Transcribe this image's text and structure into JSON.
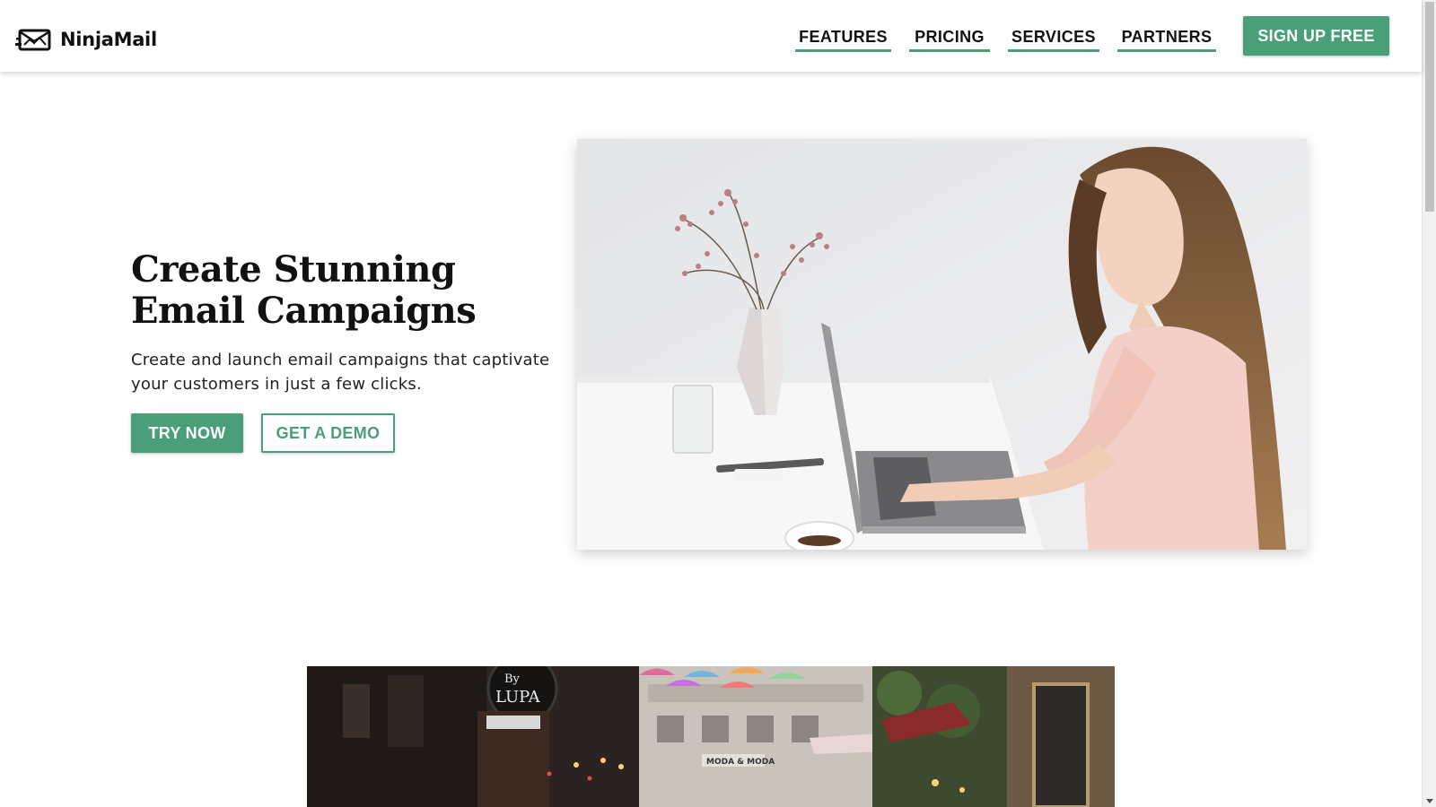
{
  "brand": {
    "name": "NinjaMail",
    "logo_icon": "envelope-icon",
    "accent_color": "#4a9e78"
  },
  "nav": {
    "items": [
      {
        "label": "FEATURES"
      },
      {
        "label": "PRICING"
      },
      {
        "label": "SERVICES"
      },
      {
        "label": "PARTNERS"
      }
    ],
    "signup_label": "SIGN UP FREE"
  },
  "hero": {
    "title": "Create Stunning Email Campaigns",
    "subtitle": "Create and launch email campaigns that captivate your customers in just a few clicks.",
    "try_label": "TRY NOW",
    "demo_label": "GET A DEMO",
    "image_alt": "woman-working-on-laptop-image"
  },
  "street": {
    "sign_text_top": "By",
    "sign_text_bottom": "LUPA",
    "shop_sign": "MODA & MODA"
  }
}
